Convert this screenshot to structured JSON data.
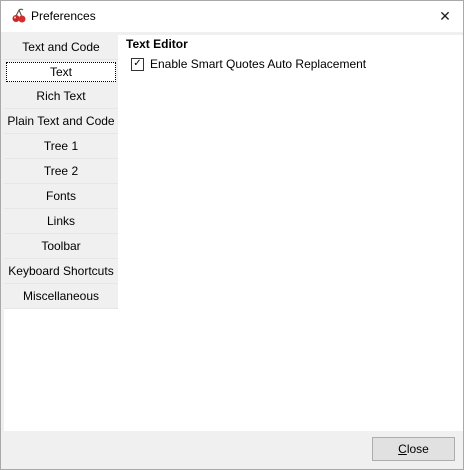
{
  "window": {
    "title": "Preferences",
    "app_icon": "cherry-icon",
    "close_glyph": "✕"
  },
  "sidebar": {
    "items": [
      {
        "label": "Text and Code",
        "active": false
      },
      {
        "label": "Text",
        "active": true
      },
      {
        "label": "Rich Text",
        "active": false
      },
      {
        "label": "Plain Text and Code",
        "active": false
      },
      {
        "label": "Tree 1",
        "active": false
      },
      {
        "label": "Tree 2",
        "active": false
      },
      {
        "label": "Fonts",
        "active": false
      },
      {
        "label": "Links",
        "active": false
      },
      {
        "label": "Toolbar",
        "active": false
      },
      {
        "label": "Keyboard Shortcuts",
        "active": false
      },
      {
        "label": "Miscellaneous",
        "active": false
      }
    ]
  },
  "content": {
    "section_title": "Text Editor",
    "options": [
      {
        "label": "Enable Smart Quotes Auto Replacement",
        "checked": true,
        "check_glyph": "✓"
      }
    ]
  },
  "footer": {
    "close_label_first": "C",
    "close_label_rest": "lose"
  }
}
